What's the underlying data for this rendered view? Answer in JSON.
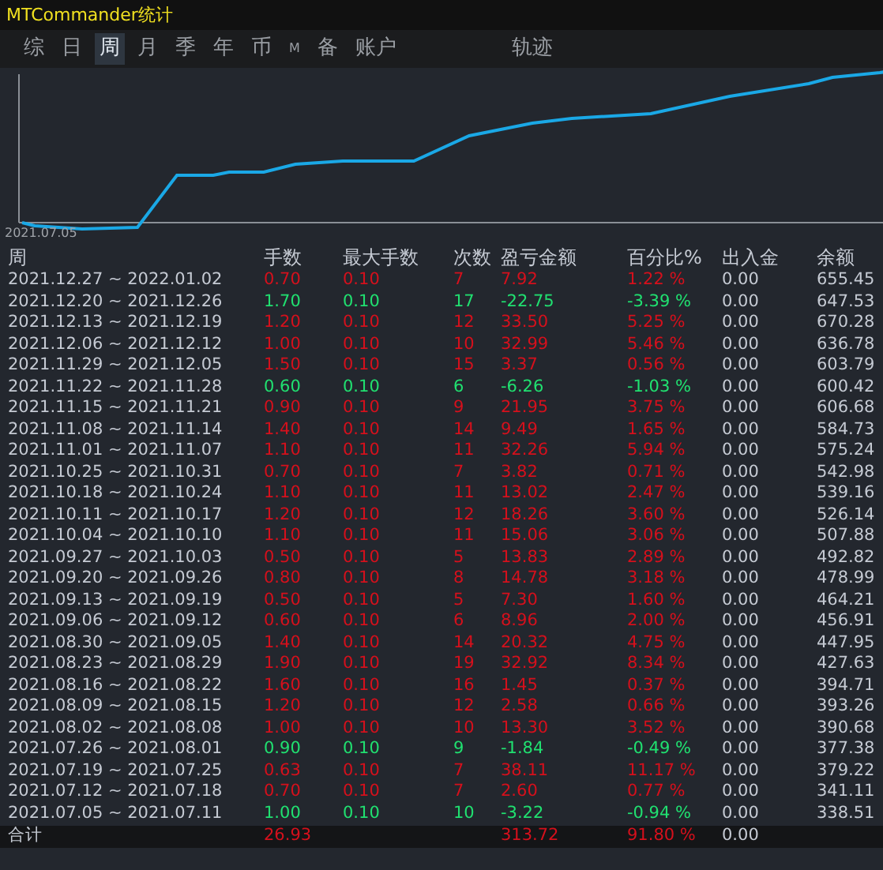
{
  "window": {
    "title": "MTCommander统计"
  },
  "tabs": [
    {
      "label": "综",
      "selected": false
    },
    {
      "label": "日",
      "selected": false
    },
    {
      "label": "周",
      "selected": true
    },
    {
      "label": "月",
      "selected": false
    },
    {
      "label": "季",
      "selected": false
    },
    {
      "label": "年",
      "selected": false
    },
    {
      "label": "币",
      "selected": false
    },
    {
      "label": "M",
      "selected": false
    },
    {
      "label": "备",
      "selected": false
    },
    {
      "label": "账户",
      "selected": false
    },
    {
      "label": "轨迹",
      "selected": false
    }
  ],
  "chart": {
    "start_label": "2021.07.05"
  },
  "table": {
    "columns": [
      "周",
      "手数",
      "最大手数",
      "次数",
      "盈亏金额",
      "百分比%",
      "出入金",
      "余额"
    ],
    "rows": [
      {
        "profit": true,
        "cells": [
          "2021.12.27 ~ 2022.01.02",
          "0.70",
          "0.10",
          "7",
          "7.92",
          "1.22 %",
          "0.00",
          "655.45"
        ]
      },
      {
        "profit": false,
        "cells": [
          "2021.12.20 ~ 2021.12.26",
          "1.70",
          "0.10",
          "17",
          "-22.75",
          "-3.39 %",
          "0.00",
          "647.53"
        ]
      },
      {
        "profit": true,
        "cells": [
          "2021.12.13 ~ 2021.12.19",
          "1.20",
          "0.10",
          "12",
          "33.50",
          "5.25 %",
          "0.00",
          "670.28"
        ]
      },
      {
        "profit": true,
        "cells": [
          "2021.12.06 ~ 2021.12.12",
          "1.00",
          "0.10",
          "10",
          "32.99",
          "5.46 %",
          "0.00",
          "636.78"
        ]
      },
      {
        "profit": true,
        "cells": [
          "2021.11.29 ~ 2021.12.05",
          "1.50",
          "0.10",
          "15",
          "3.37",
          "0.56 %",
          "0.00",
          "603.79"
        ]
      },
      {
        "profit": false,
        "cells": [
          "2021.11.22 ~ 2021.11.28",
          "0.60",
          "0.10",
          "6",
          "-6.26",
          "-1.03 %",
          "0.00",
          "600.42"
        ]
      },
      {
        "profit": true,
        "cells": [
          "2021.11.15 ~ 2021.11.21",
          "0.90",
          "0.10",
          "9",
          "21.95",
          "3.75 %",
          "0.00",
          "606.68"
        ]
      },
      {
        "profit": true,
        "cells": [
          "2021.11.08 ~ 2021.11.14",
          "1.40",
          "0.10",
          "14",
          "9.49",
          "1.65 %",
          "0.00",
          "584.73"
        ]
      },
      {
        "profit": true,
        "cells": [
          "2021.11.01 ~ 2021.11.07",
          "1.10",
          "0.10",
          "11",
          "32.26",
          "5.94 %",
          "0.00",
          "575.24"
        ]
      },
      {
        "profit": true,
        "cells": [
          "2021.10.25 ~ 2021.10.31",
          "0.70",
          "0.10",
          "7",
          "3.82",
          "0.71 %",
          "0.00",
          "542.98"
        ]
      },
      {
        "profit": true,
        "cells": [
          "2021.10.18 ~ 2021.10.24",
          "1.10",
          "0.10",
          "11",
          "13.02",
          "2.47 %",
          "0.00",
          "539.16"
        ]
      },
      {
        "profit": true,
        "cells": [
          "2021.10.11 ~ 2021.10.17",
          "1.20",
          "0.10",
          "12",
          "18.26",
          "3.60 %",
          "0.00",
          "526.14"
        ]
      },
      {
        "profit": true,
        "cells": [
          "2021.10.04 ~ 2021.10.10",
          "1.10",
          "0.10",
          "11",
          "15.06",
          "3.06 %",
          "0.00",
          "507.88"
        ]
      },
      {
        "profit": true,
        "cells": [
          "2021.09.27 ~ 2021.10.03",
          "0.50",
          "0.10",
          "5",
          "13.83",
          "2.89 %",
          "0.00",
          "492.82"
        ]
      },
      {
        "profit": true,
        "cells": [
          "2021.09.20 ~ 2021.09.26",
          "0.80",
          "0.10",
          "8",
          "14.78",
          "3.18 %",
          "0.00",
          "478.99"
        ]
      },
      {
        "profit": true,
        "cells": [
          "2021.09.13 ~ 2021.09.19",
          "0.50",
          "0.10",
          "5",
          "7.30",
          "1.60 %",
          "0.00",
          "464.21"
        ]
      },
      {
        "profit": true,
        "cells": [
          "2021.09.06 ~ 2021.09.12",
          "0.60",
          "0.10",
          "6",
          "8.96",
          "2.00 %",
          "0.00",
          "456.91"
        ]
      },
      {
        "profit": true,
        "cells": [
          "2021.08.30 ~ 2021.09.05",
          "1.40",
          "0.10",
          "14",
          "20.32",
          "4.75 %",
          "0.00",
          "447.95"
        ]
      },
      {
        "profit": true,
        "cells": [
          "2021.08.23 ~ 2021.08.29",
          "1.90",
          "0.10",
          "19",
          "32.92",
          "8.34 %",
          "0.00",
          "427.63"
        ]
      },
      {
        "profit": true,
        "cells": [
          "2021.08.16 ~ 2021.08.22",
          "1.60",
          "0.10",
          "16",
          "1.45",
          "0.37 %",
          "0.00",
          "394.71"
        ]
      },
      {
        "profit": true,
        "cells": [
          "2021.08.09 ~ 2021.08.15",
          "1.20",
          "0.10",
          "12",
          "2.58",
          "0.66 %",
          "0.00",
          "393.26"
        ]
      },
      {
        "profit": true,
        "cells": [
          "2021.08.02 ~ 2021.08.08",
          "1.00",
          "0.10",
          "10",
          "13.30",
          "3.52 %",
          "0.00",
          "390.68"
        ]
      },
      {
        "profit": false,
        "cells": [
          "2021.07.26 ~ 2021.08.01",
          "0.90",
          "0.10",
          "9",
          "-1.84",
          "-0.49 %",
          "0.00",
          "377.38"
        ]
      },
      {
        "profit": true,
        "cells": [
          "2021.07.19 ~ 2021.07.25",
          "0.63",
          "0.10",
          "7",
          "38.11",
          "11.17 %",
          "0.00",
          "379.22"
        ]
      },
      {
        "profit": true,
        "cells": [
          "2021.07.12 ~ 2021.07.18",
          "0.70",
          "0.10",
          "7",
          "2.60",
          "0.77 %",
          "0.00",
          "341.11"
        ]
      },
      {
        "profit": false,
        "cells": [
          "2021.07.05 ~ 2021.07.11",
          "1.00",
          "0.10",
          "10",
          "-3.22",
          "-0.94 %",
          "0.00",
          "338.51"
        ]
      }
    ],
    "total": {
      "profit": true,
      "label": "合计",
      "lots": "26.93",
      "pnl": "313.72",
      "percent": "91.80 %",
      "flow": "0.00"
    }
  }
}
